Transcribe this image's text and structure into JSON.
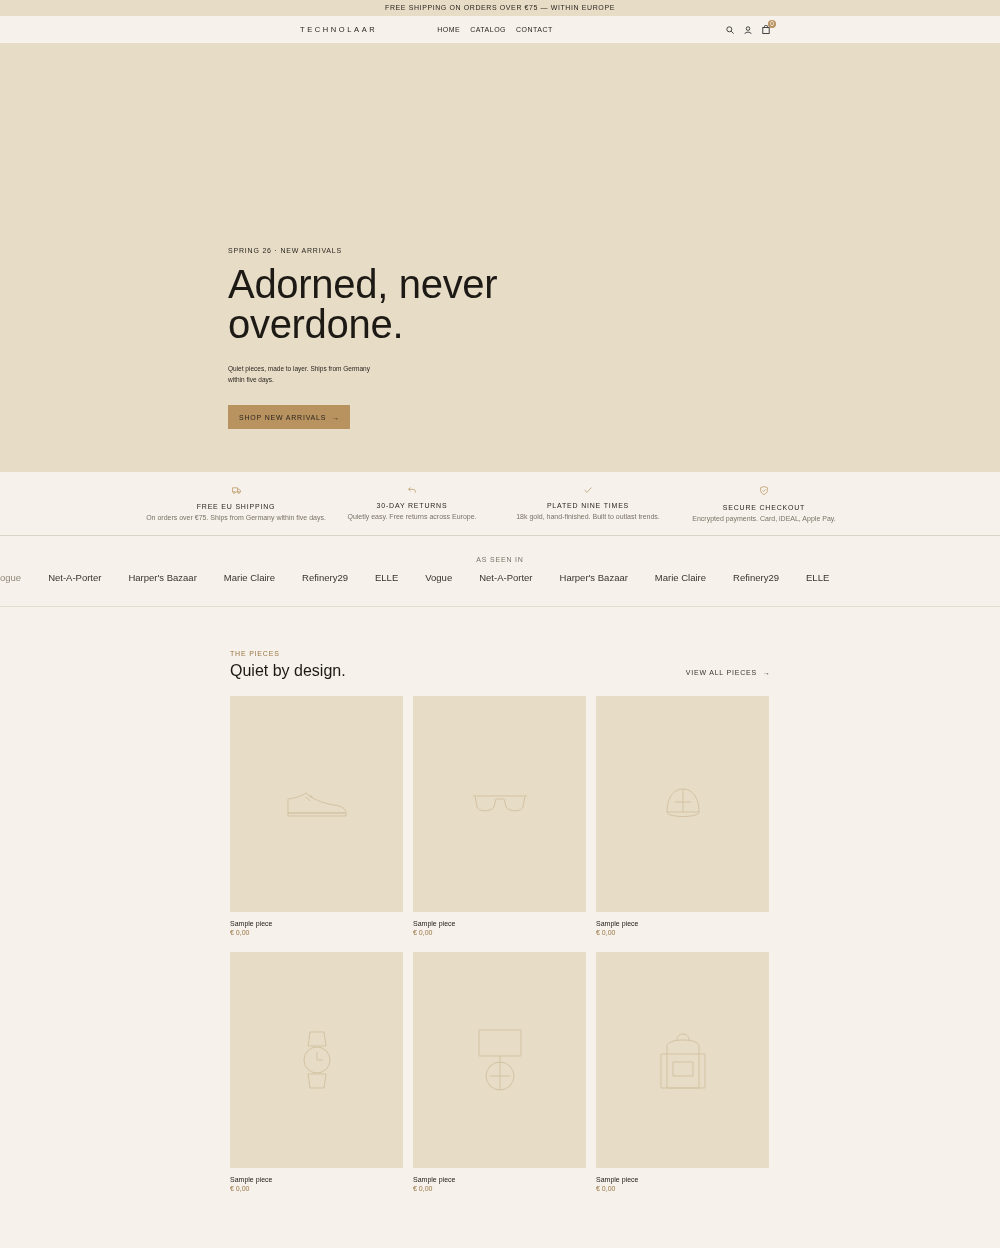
{
  "announcement": "FREE SHIPPING ON ORDERS OVER €75 — WITHIN EUROPE",
  "header": {
    "logo": "TECHNOLAAR",
    "nav": [
      {
        "label": "HOME"
      },
      {
        "label": "CATALOG"
      },
      {
        "label": "CONTACT"
      }
    ],
    "cart_count": "0"
  },
  "hero": {
    "eyebrow": "SPRING 26 · NEW ARRIVALS",
    "title": "Adorned, never overdone.",
    "text": "Quiet pieces, made to layer. Ships from Germany within five days.",
    "button": "SHOP NEW ARRIVALS",
    "button_arrow": "→"
  },
  "features": [
    {
      "kind": "truck",
      "title": "FREE EU SHIPPING",
      "text": "On orders over €75. Ships from Germany within five days."
    },
    {
      "kind": "return",
      "title": "30-DAY RETURNS",
      "text": "Quietly easy. Free returns across Europe."
    },
    {
      "kind": "check",
      "title": "PLATED NINE TIMES",
      "text": "18k gold, hand-finished. Built to outlast trends."
    },
    {
      "kind": "shield",
      "title": "SECURE CHECKOUT",
      "text": "Encrypted payments. Card, iDEAL, Apple Pay."
    }
  ],
  "press": {
    "label": "AS SEEN IN",
    "names": [
      "ogue",
      "Net-A-Porter",
      "Harper's Bazaar",
      "Marie Claire",
      "Refinery29",
      "ELLE",
      "Vogue",
      "Net-A-Porter",
      "Harper's Bazaar",
      "Marie Claire",
      "Refinery29",
      "ELLE"
    ]
  },
  "pieces": {
    "eyebrow": "THE PIECES",
    "title": "Quiet by design.",
    "link": "VIEW ALL PIECES",
    "link_arrow": "→",
    "products": [
      {
        "kind": "shoe",
        "name": "Sample piece",
        "price": "€ 0,00"
      },
      {
        "kind": "sunglasses",
        "name": "Sample piece",
        "price": "€ 0,00"
      },
      {
        "kind": "cap",
        "name": "Sample piece",
        "price": "€ 0,00"
      },
      {
        "kind": "watch",
        "name": "Sample piece",
        "price": "€ 0,00"
      },
      {
        "kind": "lamp",
        "name": "Sample piece",
        "price": "€ 0,00"
      },
      {
        "kind": "backpack",
        "name": "Sample piece",
        "price": "€ 0,00"
      }
    ]
  }
}
